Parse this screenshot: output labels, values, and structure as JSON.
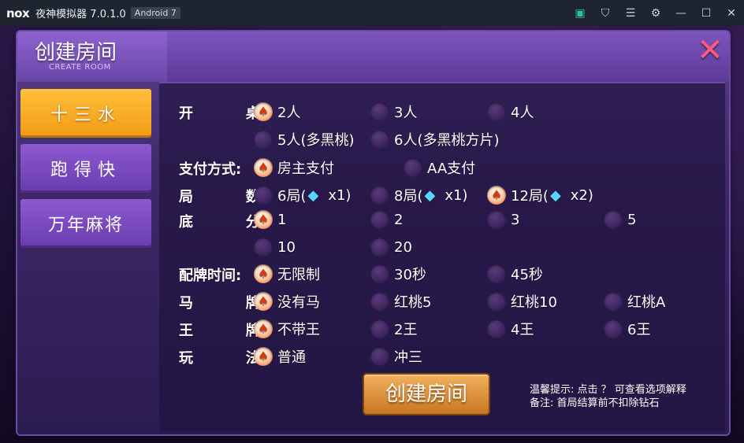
{
  "emulator": {
    "logo": "nox",
    "title": "夜神模拟器 7.0.1.0",
    "android_badge": "Android 7",
    "icons": [
      "wallet-icon",
      "shirt-icon",
      "menu-icon",
      "settings-icon",
      "minimize-icon",
      "maximize-icon",
      "close-icon"
    ]
  },
  "dialog": {
    "title": "创建房间",
    "subtitle": "CREATE ROOM",
    "close_glyph": "✕"
  },
  "sidebar": {
    "tabs": [
      {
        "label": "十三水",
        "active": true
      },
      {
        "label": "跑得快",
        "active": false
      },
      {
        "label": "万年麻将",
        "active": false
      }
    ]
  },
  "form": {
    "table": {
      "label_a": "开",
      "label_b": "桌:",
      "options": [
        "2人",
        "3人",
        "4人",
        "5人(多黑桃)",
        "6人(多黑桃方片)"
      ],
      "selected": "2人"
    },
    "payment": {
      "label": "支付方式:",
      "options": [
        "房主支付",
        "AA支付"
      ],
      "selected": "房主支付"
    },
    "rounds": {
      "label_a": "局",
      "label_b": "数:",
      "options": [
        {
          "text": "6局(",
          "mult": "x1)"
        },
        {
          "text": "8局(",
          "mult": "x1)"
        },
        {
          "text": "12局(",
          "mult": "x2)"
        }
      ],
      "selected": "12局"
    },
    "base": {
      "label_a": "底",
      "label_b": "分:",
      "options": [
        "1",
        "2",
        "3",
        "5",
        "10",
        "20"
      ],
      "selected": "1"
    },
    "time": {
      "label": "配牌时间:",
      "options": [
        "无限制",
        "30秒",
        "45秒"
      ],
      "selected": "无限制"
    },
    "horse": {
      "label_a": "马",
      "label_b": "牌:",
      "options": [
        "没有马",
        "红桃5",
        "红桃10",
        "红桃A"
      ],
      "selected": "没有马"
    },
    "king": {
      "label_a": "王",
      "label_b": "牌:",
      "options": [
        "不带王",
        "2王",
        "4王",
        "6王"
      ],
      "selected": "不带王"
    },
    "play": {
      "label_a": "玩",
      "label_b": "法:",
      "options": [
        "普通",
        "冲三"
      ],
      "selected": "普通"
    }
  },
  "create_button": "创建房间",
  "hints": {
    "line1": "温馨提示: 点击 ？ 可查看选项解释",
    "line2": "备注: 首局结算前不扣除钻石"
  }
}
